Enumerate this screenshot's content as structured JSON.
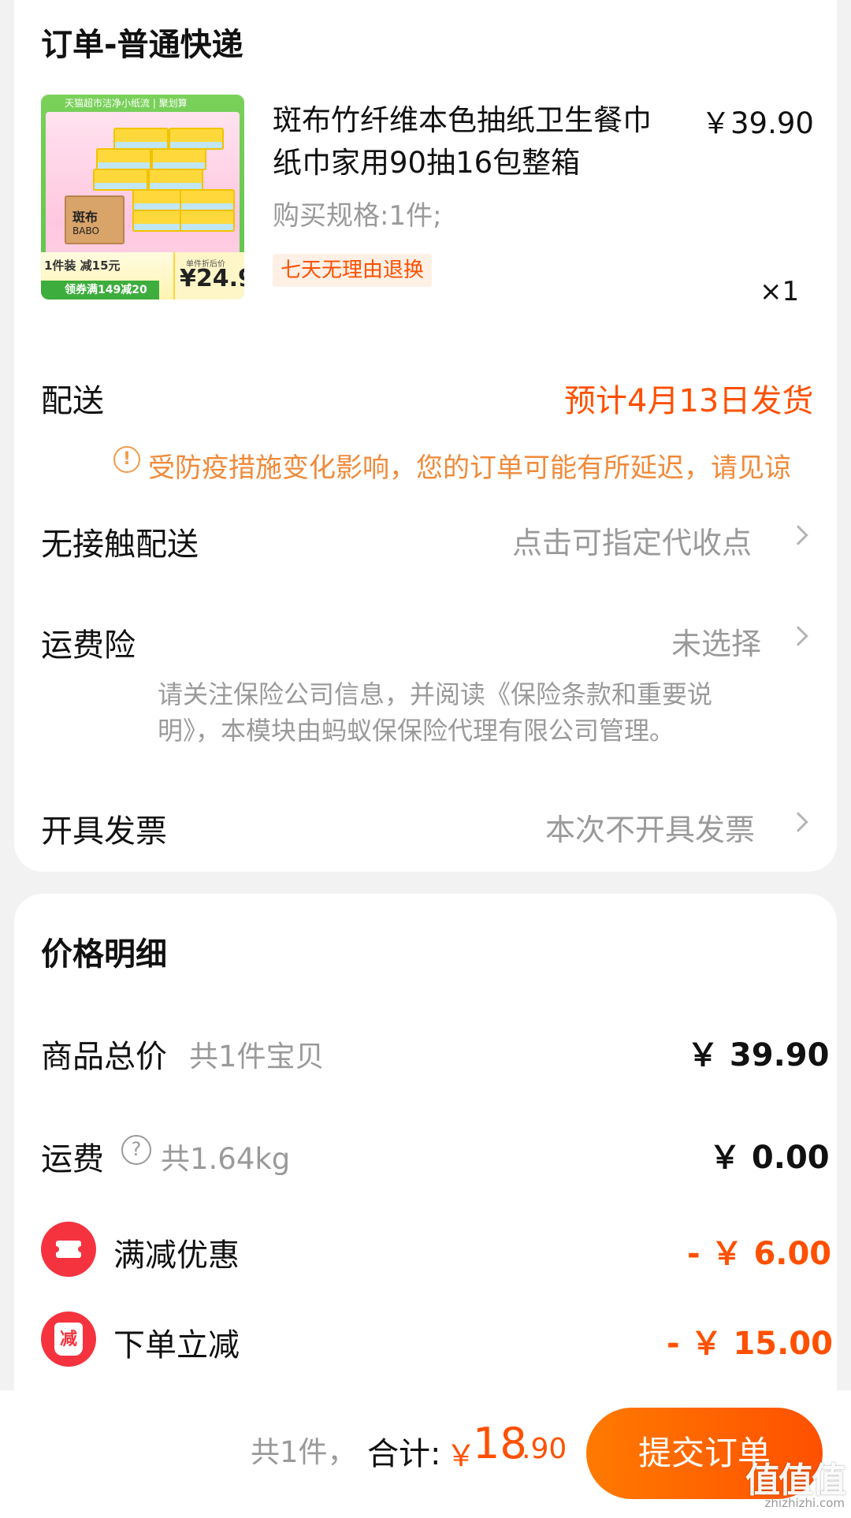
{
  "order": {
    "section_title": "订单-普通快递",
    "product": {
      "title_line1": "斑布竹纤维本色抽纸卫生餐巾",
      "title_line2": "纸巾家用90抽16包整箱",
      "price": "￥39.90",
      "spec": "购买规格:1件;",
      "tag": "七天无理由退换",
      "quantity": "×1",
      "image": {
        "top_strip": "天猫超市洁净小纸流 | 聚划算",
        "brand": "斑布",
        "brand_en": "BABO",
        "promo_line": "1件装 减15元",
        "coupon": "领券满149减20",
        "price_label": "单件折后价",
        "price_value": "¥24.9"
      }
    },
    "delivery": {
      "label": "配送",
      "value": "预计4月13日发货",
      "notice": "受防疫措施变化影响，您的订单可能有所延迟，请见谅"
    },
    "contactless": {
      "label": "无接触配送",
      "value": "点击可指定代收点"
    },
    "shipping_insurance": {
      "label": "运费险",
      "value": "未选择",
      "desc_line1": "请关注保险公司信息，并阅读《保险条款和重要说",
      "desc_line2": "明》，本模块由蚂蚁保保险代理有限公司管理。"
    },
    "invoice": {
      "label": "开具发票",
      "value": "本次不开具发票"
    }
  },
  "price_detail": {
    "title": "价格明细",
    "goods_total": {
      "label": "商品总价",
      "sub": "共1件宝贝",
      "value": "￥ 39.90"
    },
    "freight": {
      "label": "运费",
      "sub": "共1.64kg",
      "value": "￥ 0.00"
    },
    "full_reduction": {
      "label": "满减优惠",
      "value": "- ￥ 6.00"
    },
    "order_discount": {
      "label": "下单立减",
      "icon_text": "减",
      "value": "- ￥ 15.00"
    }
  },
  "footer": {
    "count": "共1件，",
    "total_label": "合计:",
    "currency": "￥",
    "total_int": "18",
    "total_dec": ".90",
    "submit": "提交订单",
    "watermark": "值值值",
    "watermark_url": "zhizhizhi.com"
  },
  "colors": {
    "accent": "#ff5000",
    "page_bg": "#f2f2f2",
    "icon_red": "#f5333f"
  }
}
